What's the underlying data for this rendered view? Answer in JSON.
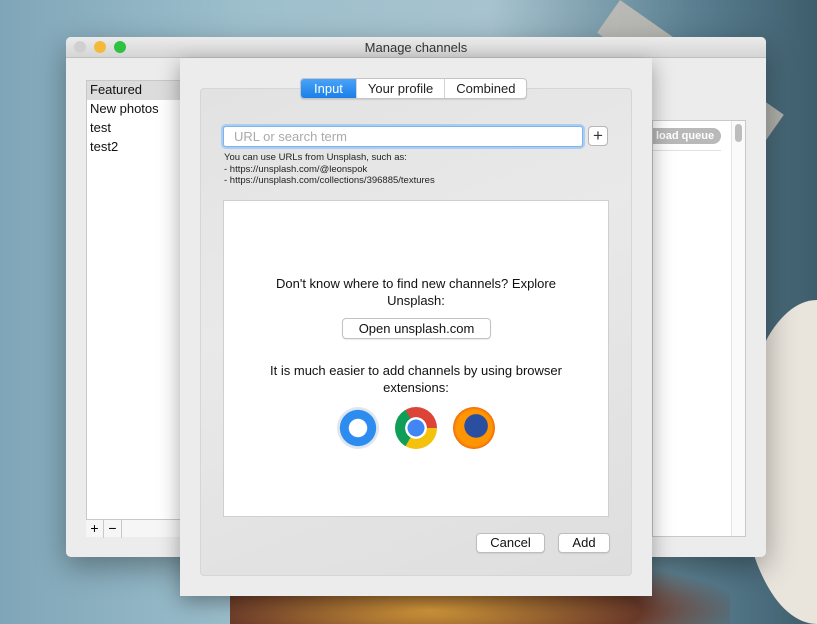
{
  "window": {
    "title": "Manage channels"
  },
  "channels": {
    "items": [
      "Featured",
      "New photos",
      "test",
      "test2"
    ],
    "add": "+",
    "remove": "−"
  },
  "queue": {
    "label": "load queue"
  },
  "sheet": {
    "tabs": [
      "Input",
      "Your profile",
      "Combined"
    ],
    "input": {
      "placeholder": "URL or search term",
      "value": ""
    },
    "plus": "+",
    "help": [
      "You can use URLs from Unsplash, such as:",
      "- https://unsplash.com/@leonspok",
      "- https://unsplash.com/collections/396885/textures"
    ],
    "explore_text": "Don't know where to find new channels? Explore Unsplash:",
    "open_button": "Open unsplash.com",
    "extensions_text": "It is much easier to add channels by using browser extensions:",
    "browsers": [
      "safari-icon",
      "chrome-icon",
      "firefox-icon"
    ],
    "cancel": "Cancel",
    "add": "Add"
  }
}
